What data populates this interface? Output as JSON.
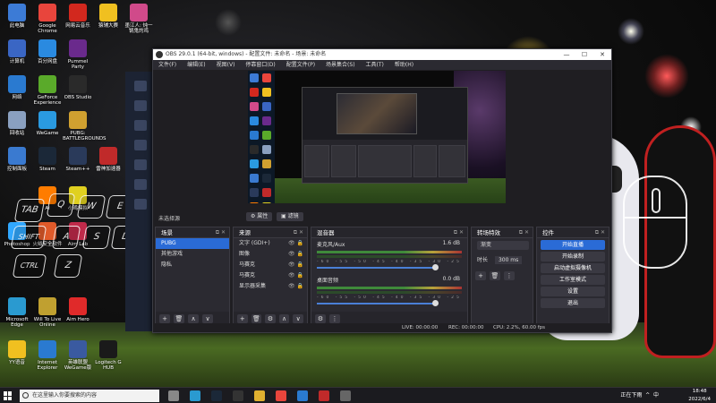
{
  "desktop_icons": [
    {
      "label": "此电脑",
      "color": "#3c7bd6"
    },
    {
      "label": "Google Chrome",
      "color": "#e8453c"
    },
    {
      "label": "网易云音乐",
      "color": "#d2281e"
    },
    {
      "label": "猿辅大赛",
      "color": "#f0c020"
    },
    {
      "label": "墨江人: 炖一锅鬼的鸡",
      "color": "#d04a8a"
    },
    {
      "label": "计算机",
      "color": "#3a66c4"
    },
    {
      "label": "百分网盘",
      "color": "#2a8ae0"
    },
    {
      "label": "Pummel Party",
      "color": "#6a2a8c"
    },
    {
      "label": "网络",
      "color": "#2a7ad0"
    },
    {
      "label": "GeForce Experience",
      "color": "#5aaa2a"
    },
    {
      "label": "OBS Studio",
      "color": "#2a2a2a"
    },
    {
      "label": "回收站",
      "color": "#8aa0c0"
    },
    {
      "label": "WeGame",
      "color": "#2a9ae0"
    },
    {
      "label": "PUBG: BATTLEGROUNDS",
      "color": "#d0a030"
    },
    {
      "label": "控制面板",
      "color": "#3a7ad0"
    },
    {
      "label": "Steam",
      "color": "#1b2838"
    },
    {
      "label": "Steam++",
      "color": "#2a3a5a"
    },
    {
      "label": "雷神加速器",
      "color": "#c02a2a"
    },
    {
      "label": "Ai",
      "color": "#ff7c00"
    },
    {
      "label": "小鸡模拟",
      "color": "#e0d020"
    },
    {
      "label": "Photoshop",
      "color": "#31a8ff"
    },
    {
      "label": "火绒安全软件",
      "color": "#e05a2a"
    },
    {
      "label": "Aim Lab",
      "color": "#c02a4a"
    },
    {
      "label": "Microsoft Edge",
      "color": "#2a9ad0"
    },
    {
      "label": "Will To Live Online",
      "color": "#c0a030"
    },
    {
      "label": "Aim Hero",
      "color": "#e02a2a"
    },
    {
      "label": "YY语音",
      "color": "#f0c020"
    },
    {
      "label": "Internet Explorer",
      "color": "#2a7ad0"
    },
    {
      "label": "英雄联盟 WeGame版",
      "color": "#3a5aa0"
    },
    {
      "label": "Logitech G HUB",
      "color": "#1a1a1a"
    }
  ],
  "overlay_keys": [
    "TAB",
    "Q",
    "W",
    "E",
    "R",
    "SHIFT",
    "A",
    "S",
    "D",
    "F",
    "CTRL",
    "Z"
  ],
  "obs": {
    "title": "OBS 29.0.1 (64-bit, windows) - 配置文件: 未命名 - 场景: 未命名",
    "window_buttons": [
      "—",
      "☐",
      "✕"
    ],
    "menu": [
      "文件(F)",
      "编辑(E)",
      "视图(V)",
      "停靠窗口(D)",
      "配置文件(P)",
      "场景集合(S)",
      "工具(T)",
      "帮助(H)"
    ],
    "scene_bar_label": "未选择源",
    "scene_bar_buttons": [
      "属性",
      "滤镜"
    ],
    "scenes_dock": {
      "title": "场景",
      "items": [
        "PUBG",
        "其他游戏",
        "隐私"
      ],
      "selected": "PUBG"
    },
    "sources_dock": {
      "title": "来源",
      "items": [
        "文字 (GDI+)",
        "图像",
        "马赛克",
        "马赛克",
        "显示器采集"
      ]
    },
    "mixer_dock": {
      "title": "混音器",
      "tracks": [
        {
          "name": "麦克风/Aux",
          "db": "1.6 dB"
        },
        {
          "name": "桌面音频",
          "db": "0.0 dB"
        }
      ],
      "ticks": "-60 -55 -50 -45 -40 -35 -30 -25 -20 -15 -10 -5 0"
    },
    "transitions_dock": {
      "title": "转场特效",
      "selected": "渐变",
      "duration_label": "时长",
      "duration": "300 ms"
    },
    "controls_dock": {
      "title": "控件",
      "buttons": [
        "开始直播",
        "开始录制",
        "启动虚拟摄像机",
        "工作室模式",
        "设置",
        "退出"
      ]
    },
    "status": {
      "live": "LIVE: 00:00:00",
      "rec": "REC: 00:00:00",
      "cpu": "CPU: 2.2%, 60.00 fps"
    }
  },
  "taskbar": {
    "search_placeholder": "在这里输入你要搜索的内容",
    "tray_text": "正在下雨",
    "ime": "中",
    "time": "18:48",
    "date": "2022/6/4",
    "apps": [
      "task-view",
      "edge",
      "steam",
      "obs",
      "folder",
      "chrome",
      "qq",
      "wegame",
      "settings"
    ]
  }
}
